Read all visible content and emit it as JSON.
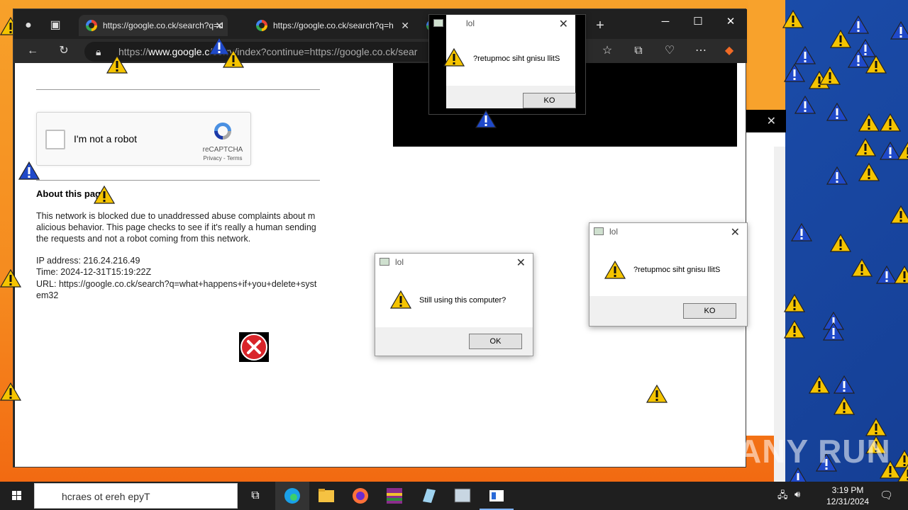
{
  "browser": {
    "tabs": [
      {
        "label": "https://google.co.ck/search?q=d"
      },
      {
        "label": "https://google.co.ck/search?q=h"
      },
      {
        "label": ""
      }
    ],
    "address_prefix": "https://",
    "address_domain": "www.google.c",
    "address_rest": "/sorry/index?continue=https://google.co.ck/sear"
  },
  "page": {
    "captcha_label": "I'm not a robot",
    "captcha_brand": "reCAPTCHA",
    "captcha_links": "Privacy - Terms",
    "about_title": "About this pag",
    "about_text": "This network is blocked due to unaddressed abuse complaints about malicious behavior. This page checks to see if it's really a human sending the requests and not a robot coming from this network.",
    "ip": "IP address: 216.24.216.49",
    "time": "Time: 2024-12-31T15:19:22Z",
    "url": "URL: https://google.co.ck/search?q=what+happens+if+you+delete+system32"
  },
  "dialogs": [
    {
      "title": "lol",
      "message": "?retupmoc siht gnisu llitS",
      "button": "KO"
    },
    {
      "title": "lol",
      "message": "Still using this computer?",
      "button": "OK"
    },
    {
      "title": "lol",
      "message": "?retupmoc siht gnisu llitS",
      "button": "KO"
    }
  ],
  "taskbar": {
    "search_placeholder": "hcraes ot ereh epyT",
    "time": "3:19 PM",
    "date": "12/31/2024"
  },
  "watermark": "ANY RUN",
  "colors": {
    "warning_yellow": "#f5c400",
    "warning_blue": "#1f49c9",
    "error_red": "#d9252a"
  }
}
